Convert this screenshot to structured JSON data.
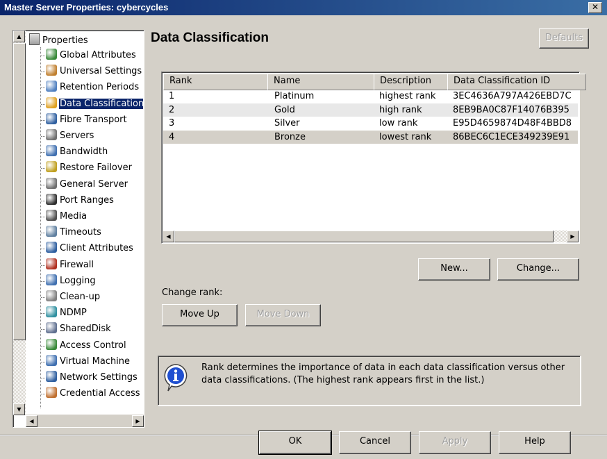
{
  "window": {
    "title": "Master Server Properties: cybercycles",
    "close_glyph": "✕"
  },
  "tree": {
    "root_label": "Properties",
    "items": [
      {
        "label": "Global Attributes",
        "icon": "globe-icon",
        "color": "#3a8a3a",
        "selected": false
      },
      {
        "label": "Universal Settings",
        "icon": "universal-settings-icon",
        "color": "#c08030",
        "selected": false
      },
      {
        "label": "Retention Periods",
        "icon": "retention-icon",
        "color": "#5080c0",
        "selected": false
      },
      {
        "label": "Data Classification",
        "icon": "data-classification-icon",
        "color": "#e0a020",
        "selected": true
      },
      {
        "label": "Fibre Transport",
        "icon": "fibre-transport-icon",
        "color": "#3060a0",
        "selected": false
      },
      {
        "label": "Servers",
        "icon": "server-icon",
        "color": "#707070",
        "selected": false
      },
      {
        "label": "Bandwidth",
        "icon": "bandwidth-icon",
        "color": "#4070b0",
        "selected": false
      },
      {
        "label": "Restore Failover",
        "icon": "restore-failover-icon",
        "color": "#c0a020",
        "selected": false
      },
      {
        "label": "General Server",
        "icon": "general-server-icon",
        "color": "#707070",
        "selected": false
      },
      {
        "label": "Port Ranges",
        "icon": "port-ranges-icon",
        "color": "#303030",
        "selected": false
      },
      {
        "label": "Media",
        "icon": "media-icon",
        "color": "#505050",
        "selected": false
      },
      {
        "label": "Timeouts",
        "icon": "timeouts-icon",
        "color": "#6080a0",
        "selected": false
      },
      {
        "label": "Client Attributes",
        "icon": "client-attributes-icon",
        "color": "#3060a0",
        "selected": false
      },
      {
        "label": "Firewall",
        "icon": "firewall-icon",
        "color": "#b03020",
        "selected": false
      },
      {
        "label": "Logging",
        "icon": "logging-icon",
        "color": "#4070b0",
        "selected": false
      },
      {
        "label": "Clean-up",
        "icon": "clean-up-icon",
        "color": "#808080",
        "selected": false
      },
      {
        "label": "NDMP",
        "icon": "ndmp-icon",
        "color": "#3090a0",
        "selected": false
      },
      {
        "label": "SharedDisk",
        "icon": "shared-disk-icon",
        "color": "#607090",
        "selected": false
      },
      {
        "label": "Access Control",
        "icon": "access-control-icon",
        "color": "#3a8a3a",
        "selected": false
      },
      {
        "label": "Virtual Machine",
        "icon": "virtual-machine-icon",
        "color": "#4070b0",
        "selected": false
      },
      {
        "label": "Network Settings",
        "icon": "network-settings-icon",
        "color": "#3060a0",
        "selected": false
      },
      {
        "label": "Credential Access",
        "icon": "credential-access-icon",
        "color": "#c07030",
        "selected": false
      }
    ]
  },
  "page": {
    "title": "Data Classification",
    "defaults_label": "Defaults"
  },
  "table": {
    "columns": [
      "Rank",
      "Name",
      "Description",
      "Data Classification ID"
    ],
    "rows": [
      [
        "1",
        "Platinum",
        "highest rank",
        "3EC4636A797A426EBD7C"
      ],
      [
        "2",
        "Gold",
        "high rank",
        "8EB9BA0C87F14076B395"
      ],
      [
        "3",
        "Silver",
        "low rank",
        "E95D4659874D48F4BBD8"
      ],
      [
        "4",
        "Bronze",
        "lowest rank",
        "86BEC6C1ECE349239E91"
      ]
    ]
  },
  "buttons": {
    "new": "New...",
    "change": "Change...",
    "change_rank_label": "Change rank:",
    "move_up": "Move Up",
    "move_down": "Move Down",
    "ok": "OK",
    "cancel": "Cancel",
    "apply": "Apply",
    "help": "Help"
  },
  "info": {
    "icon": "info-icon",
    "text": "Rank determines the importance of data in each data classification versus other data classifications. (The highest rank appears first in the list.)"
  }
}
